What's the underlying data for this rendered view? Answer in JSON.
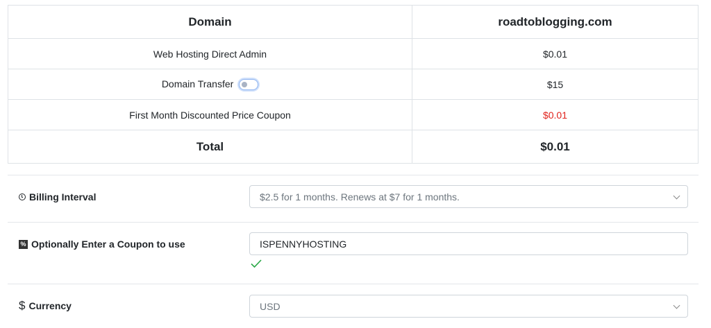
{
  "table": {
    "header": {
      "left": "Domain",
      "right": "roadtoblogging.com"
    },
    "rows": [
      {
        "label": "Web Hosting Direct Admin",
        "value": "$0.01",
        "highlight": false
      },
      {
        "label": "Domain Transfer",
        "value": "$15",
        "has_toggle": true,
        "toggle_on": false
      },
      {
        "label": "First Month Discounted Price Coupon",
        "value": "$0.01",
        "highlight": true,
        "highlight_color": "#e0201a"
      }
    ],
    "total": {
      "label": "Total",
      "value": "$0.01"
    }
  },
  "billing": {
    "label": "Billing Interval",
    "icon": "clock-icon",
    "selected": "$2.5 for 1 months. Renews at $7 for 1 months."
  },
  "coupon": {
    "label": "Optionally Enter a Coupon to use",
    "icon": "coupon-icon",
    "value": "ISPENNYHOSTING",
    "valid": true,
    "valid_color": "#28a745"
  },
  "currency": {
    "label": "Currency",
    "icon": "dollar-icon",
    "selected": "USD"
  }
}
